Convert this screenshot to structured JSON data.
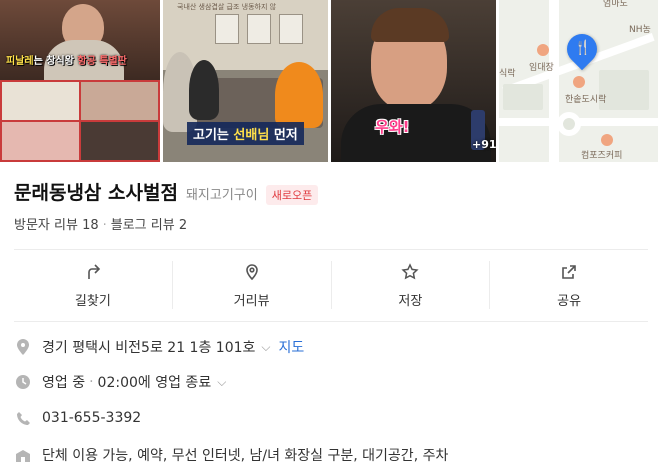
{
  "photos": {
    "p1_caption_a": "피날레",
    "p1_caption_b": "는 창식왕",
    "p1_caption_c": " 항공 특별판",
    "p2_sign": "국내산 생삼겹살 급조 냉동하지 않",
    "p2_caption_a": "고기",
    "p2_caption_b": "는 ",
    "p2_caption_c": "선배님",
    "p2_caption_d": " 먼저",
    "p3_caption": "우와!",
    "more_count": "+91"
  },
  "map": {
    "label_top": "엄마도",
    "label_nh": "NH농",
    "label_left": "식락",
    "label_imdaejang": "임대장",
    "label_hansot": "한솥도시락",
    "label_compose": "컴포즈커피"
  },
  "place": {
    "name": "문래동냉삼 소사벌점",
    "category": "돼지고기구이",
    "badge": "새로오픈",
    "visitor_reviews": "방문자 리뷰 18",
    "blog_reviews": "블로그 리뷰 2"
  },
  "actions": [
    {
      "label": "길찾기",
      "icon": "directions-icon"
    },
    {
      "label": "거리뷰",
      "icon": "map-pin-icon"
    },
    {
      "label": "저장",
      "icon": "star-icon"
    },
    {
      "label": "공유",
      "icon": "share-icon"
    }
  ],
  "details": {
    "address": "경기 평택시 비전5로 21 1층 101호",
    "map_link": "지도",
    "status": "영업 중",
    "status_detail": "02:00에 영업 종료",
    "phone": "031-655-3392",
    "amenities": "단체 이용 가능, 예약, 무선 인터넷, 남/녀 화장실 구분, 대기공간, 주차"
  },
  "colors": {
    "accent_blue": "#2a6fd6",
    "badge_red": "#e0393e",
    "pin_blue": "#2f7bf0"
  }
}
